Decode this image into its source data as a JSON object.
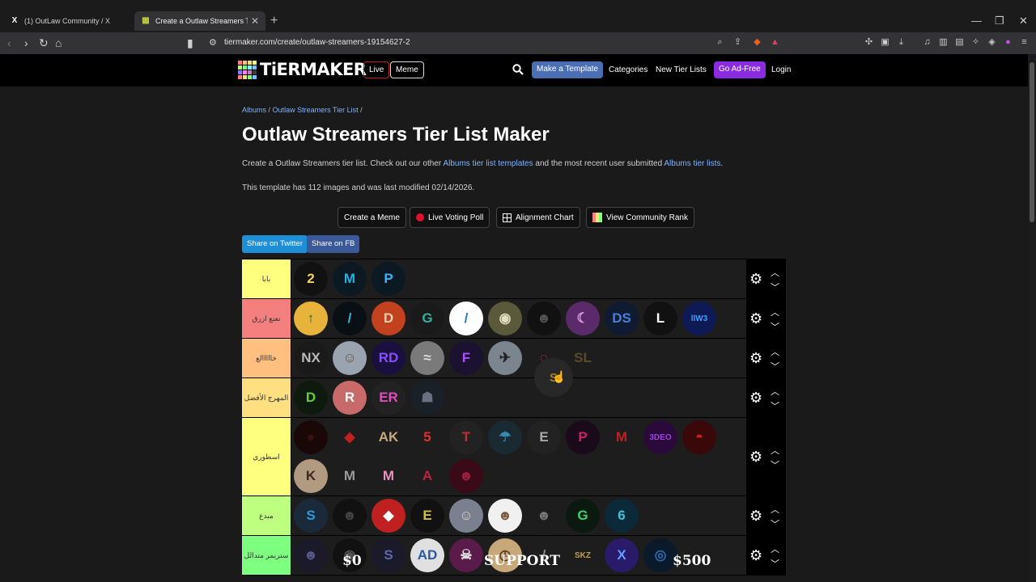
{
  "browser": {
    "tabs": [
      {
        "title": "(1) OutLaw Community / X",
        "icon": "x-logo-icon"
      },
      {
        "title": "Create a Outlaw Streamers Tier L",
        "icon": "tiermaker-favicon-icon"
      }
    ],
    "url": "tiermaker.com/create/outlaw-streamers-19154627-2"
  },
  "header": {
    "logo_text": "TiERMAKER",
    "live": "Live",
    "meme": "Meme",
    "make_template": "Make a Template",
    "categories": "Categories",
    "new_tier_lists": "New Tier Lists",
    "go_ad_free": "Go Ad-Free",
    "login": "Login"
  },
  "breadcrumb": {
    "albums": "Albums",
    "outlaw": "Outlaw Streamers Tier List",
    "sep": "/"
  },
  "page": {
    "title": "Outlaw Streamers Tier List Maker",
    "desc_1": "Create a Outlaw Streamers tier list. Check out our other",
    "desc_link_1": "Albums tier list templates",
    "desc_2": "and the most recent user submitted",
    "desc_link_2": "Albums tier lists",
    "desc_3": ".",
    "meta": "This template has 112 images and was last modified 02/14/2026."
  },
  "actions": {
    "create_meme": "Create a Meme",
    "live_voting": "Live Voting Poll",
    "alignment": "Alignment Chart",
    "community_rank": "View Community Rank"
  },
  "share": {
    "twitter": "Share on Twitter",
    "fb": "Share on FB"
  },
  "colors": {
    "accent_blue": "#4a6fb5",
    "ad_free": "#8a2be2",
    "live_red": "#c12020"
  },
  "tiers": [
    {
      "label": "بابا",
      "color": "#ffff7f",
      "items": [
        {
          "t": "2",
          "bg": "#111",
          "fg": "#f4d35e"
        },
        {
          "t": "M",
          "bg": "#0b1a22",
          "fg": "#2ab0e0"
        },
        {
          "t": "P",
          "bg": "#0b1a22",
          "fg": "#3bb5ff"
        }
      ]
    },
    {
      "label": "نعنع ازرق",
      "color": "#f47f7f",
      "items": [
        {
          "t": "↑",
          "bg": "#e8b33a",
          "fg": "#1d6b3a"
        },
        {
          "t": "/",
          "bg": "#0a0f14",
          "fg": "#37b8d8"
        },
        {
          "t": "D",
          "bg": "#c2411f",
          "fg": "#f3d1b0"
        },
        {
          "t": "G",
          "bg": "#1a1a1a",
          "fg": "#36b0a0"
        },
        {
          "t": "/",
          "bg": "#ffffff",
          "fg": "#2a7dc2"
        },
        {
          "t": "◉",
          "bg": "#5a5a3a",
          "fg": "#e0e0c0"
        },
        {
          "t": "☻",
          "bg": "#111",
          "fg": "#555"
        },
        {
          "t": "☾",
          "bg": "#5a2a6a",
          "fg": "#e0a0e0"
        },
        {
          "t": "DS",
          "bg": "#0f1a33",
          "fg": "#4a7fd8"
        },
        {
          "t": "L",
          "bg": "#111",
          "fg": "#fff"
        },
        {
          "t": "llW3",
          "bg": "#0e1a55",
          "fg": "#3aa0ff"
        }
      ]
    },
    {
      "label": "خااااالع",
      "color": "#ffbf7f",
      "items": [
        {
          "t": "NX",
          "bg": "#1a1a1a",
          "fg": "#bbb"
        },
        {
          "t": "☺",
          "bg": "#9aa3b0",
          "fg": "#6a5040"
        },
        {
          "t": "RD",
          "bg": "#1a1040",
          "fg": "#8a4cff"
        },
        {
          "t": "≈",
          "bg": "#7a7a7a",
          "fg": "#ddd"
        },
        {
          "t": "F",
          "bg": "#1a1230",
          "fg": "#b04cff"
        },
        {
          "t": "✈",
          "bg": "#7a8590",
          "fg": "#222"
        },
        {
          "t": "◌",
          "bg": "#1d1d1d",
          "fg": "#c23030"
        },
        {
          "t": "SL",
          "bg": "#1d1d1d",
          "fg": "#5a4a2a"
        }
      ]
    },
    {
      "label": "المهرج الأفضل",
      "color": "#ffdf7f",
      "items": [
        {
          "t": "D",
          "bg": "#0f1a0f",
          "fg": "#5cd33a"
        },
        {
          "t": "R",
          "bg": "#c86a6a",
          "fg": "#fff"
        },
        {
          "t": "ER",
          "bg": "#222",
          "fg": "#e04cc0"
        },
        {
          "t": "☗",
          "bg": "#1a2028",
          "fg": "#6a7080"
        }
      ]
    },
    {
      "label": "اسطوري",
      "color": "#ffff7f",
      "items": [
        {
          "t": "●",
          "bg": "#1a0808",
          "fg": "#3a1010"
        },
        {
          "t": "◆",
          "bg": "#1d1d1d",
          "fg": "#c02020"
        },
        {
          "t": "AK",
          "bg": "#1d1d1d",
          "fg": "#c8a878"
        },
        {
          "t": "5",
          "bg": "#1d1d1d",
          "fg": "#e03030"
        },
        {
          "t": "T",
          "bg": "#222",
          "fg": "#c03030"
        },
        {
          "t": "☂",
          "bg": "#1a2a33",
          "fg": "#3a8ab0"
        },
        {
          "t": "E",
          "bg": "#222",
          "fg": "#aaa"
        },
        {
          "t": "P",
          "bg": "#1a0a1a",
          "fg": "#d02070"
        },
        {
          "t": "M",
          "bg": "#1d1d1d",
          "fg": "#c02020"
        },
        {
          "t": "3DEO",
          "bg": "#2a0a3a",
          "fg": "#a040e0"
        },
        {
          "t": "◓",
          "bg": "#3a0808",
          "fg": "#d02020"
        },
        {
          "t": "K",
          "bg": "#b09a80",
          "fg": "#3a2a20"
        },
        {
          "t": "M",
          "bg": "#1d1d1d",
          "fg": "#999"
        },
        {
          "t": "M",
          "bg": "#1d1d1d",
          "fg": "#e890c0"
        },
        {
          "t": "A",
          "bg": "#1d1d1d",
          "fg": "#c02040"
        },
        {
          "t": "☻",
          "bg": "#3a0a18",
          "fg": "#a02040"
        }
      ]
    },
    {
      "label": "مبدع",
      "color": "#bfff7f",
      "items": [
        {
          "t": "S",
          "bg": "#1a2a3a",
          "fg": "#2a9ae0"
        },
        {
          "t": "☻",
          "bg": "#111",
          "fg": "#444"
        },
        {
          "t": "◆",
          "bg": "#c02020",
          "fg": "#fff"
        },
        {
          "t": "E",
          "bg": "#111",
          "fg": "#d4c040"
        },
        {
          "t": "☺",
          "bg": "#7a8090",
          "fg": "#e0d0c0"
        },
        {
          "t": "☻",
          "bg": "#f0f0f0",
          "fg": "#7a5a40"
        },
        {
          "t": "☻",
          "bg": "#1d1d1d",
          "fg": "#777"
        },
        {
          "t": "G",
          "bg": "#0a1a10",
          "fg": "#40d070"
        },
        {
          "t": "6",
          "bg": "#0a2a3a",
          "fg": "#40c0e0"
        }
      ]
    },
    {
      "label": "ستريمر متدالل",
      "color": "#7fff7f",
      "items": [
        {
          "t": "☻",
          "bg": "#1a1a2a",
          "fg": "#5a5a8a"
        },
        {
          "t": "◉",
          "bg": "#111",
          "fg": "#555"
        },
        {
          "t": "S",
          "bg": "#1a1a2a",
          "fg": "#5a6ab0"
        },
        {
          "t": "AD",
          "bg": "#e0e0e0",
          "fg": "#2a5aa0"
        },
        {
          "t": "☠",
          "bg": "#5a1a4a",
          "fg": "#e0e0e0"
        },
        {
          "t": "◷",
          "bg": "#c8a878",
          "fg": "#5a3a20"
        },
        {
          "t": "/",
          "bg": "#1d1d1d",
          "fg": "#888"
        },
        {
          "t": "SKZ",
          "bg": "#1d1d1d",
          "fg": "#c0a050"
        },
        {
          "t": "X",
          "bg": "#2a1a6a",
          "fg": "#60a0ff"
        },
        {
          "t": "◎",
          "bg": "#0a1a2a",
          "fg": "#2a6ab0"
        }
      ]
    }
  ],
  "support": {
    "left": "$0",
    "middle": "SUPPORT",
    "right": "$500"
  }
}
